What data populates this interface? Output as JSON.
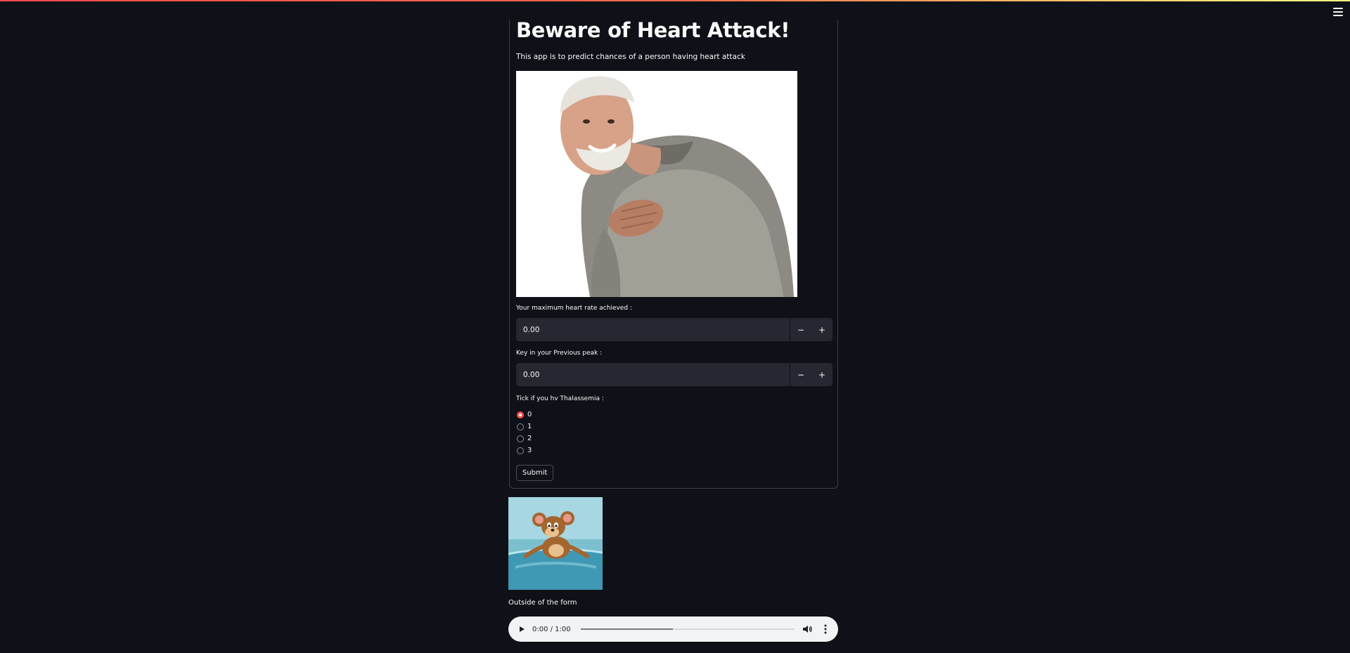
{
  "app": {
    "menu_icon": "hamburger-menu-icon",
    "accent_color": "#ff4b4b",
    "background_color": "#0e1117"
  },
  "form": {
    "title": "Beware of Heart Attack!",
    "subtitle": "This app is to predict chances of a person having heart attack",
    "hero_image": "man-holding-chest-photo",
    "fields": [
      {
        "label": "Your maximum heart rate achieved :",
        "value": "0.00",
        "decrement": "−",
        "increment": "+"
      },
      {
        "label": "Key in your Previous peak :",
        "value": "0.00",
        "decrement": "−",
        "increment": "+"
      }
    ],
    "radio": {
      "label": "Tick if you hv Thalassemia :",
      "options": [
        "0",
        "1",
        "2",
        "3"
      ],
      "selected": "0"
    },
    "submit_label": "Submit"
  },
  "outside": {
    "image": "cartoon-mouse-in-bowl",
    "text": "Outside of the form"
  },
  "audio": {
    "time": "0:00 / 1:00",
    "buffered_fraction": 0.43,
    "play_icon": "play-icon",
    "volume_icon": "volume-icon",
    "more_icon": "more-options-icon"
  }
}
